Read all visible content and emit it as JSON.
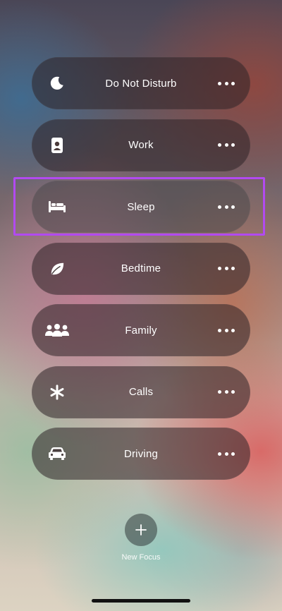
{
  "focus_modes": [
    {
      "label": "Do Not Disturb",
      "icon": "moon-icon"
    },
    {
      "label": "Work",
      "icon": "id-badge-icon"
    },
    {
      "label": "Sleep",
      "icon": "bed-icon"
    },
    {
      "label": "Bedtime",
      "icon": "leaf-icon"
    },
    {
      "label": "Family",
      "icon": "people-icon"
    },
    {
      "label": "Calls",
      "icon": "asterisk-icon"
    },
    {
      "label": "Driving",
      "icon": "car-icon"
    }
  ],
  "highlighted_item": "Sleep",
  "new_focus": {
    "label": "New Focus",
    "icon": "plus-icon"
  },
  "colors": {
    "highlight": "#b24af0",
    "text": "#ffffff"
  }
}
